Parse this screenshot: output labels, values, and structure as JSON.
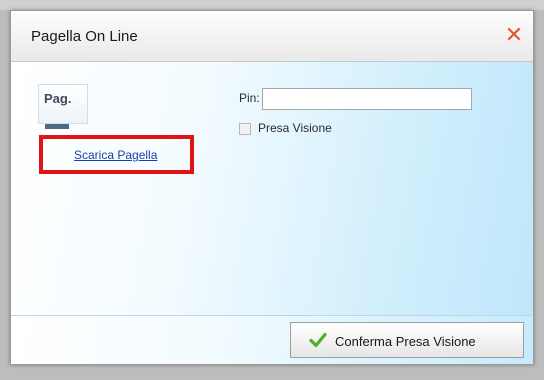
{
  "dialog": {
    "title": "Pagella On Line",
    "close_icon": "close-icon"
  },
  "left_panel": {
    "icon_label": "Pag.",
    "link_label": "Scarica Pagella"
  },
  "form": {
    "pin_label": "Pin:",
    "pin_value": "",
    "pin_placeholder": "",
    "presa_visione_label": "Presa Visione",
    "presa_visione_checked": false
  },
  "footer": {
    "confirm_button_label": "Conferma Presa Visione",
    "confirm_icon": "check-icon"
  },
  "colors": {
    "highlight": "#e01414",
    "close": "#e0563b",
    "check": "#4caf2a",
    "link": "#1b3fa8"
  }
}
